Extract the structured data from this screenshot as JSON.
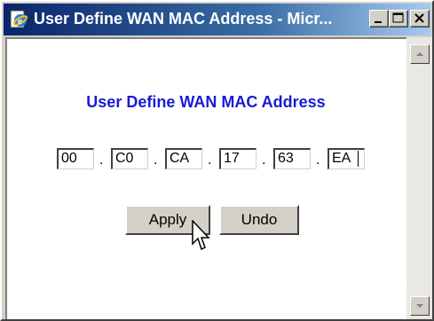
{
  "window": {
    "title": "User Define WAN MAC Address - Micr...",
    "title_icon": "ie-page-icon",
    "controls": [
      "minimize-icon",
      "maximize-icon",
      "close-icon"
    ]
  },
  "page": {
    "heading": "User Define WAN MAC Address",
    "heading_color": "#1a1ad4",
    "mac_octets": [
      "00",
      "C0",
      "CA",
      "17",
      "63",
      "EA"
    ],
    "separator": ".",
    "apply_label": "Apply",
    "undo_label": "Undo"
  },
  "scrollbar": {
    "up_icon": "scroll-up-arrow-icon",
    "down_icon": "scroll-down-arrow-icon"
  },
  "pointer_icon": "mouse-pointer-icon"
}
